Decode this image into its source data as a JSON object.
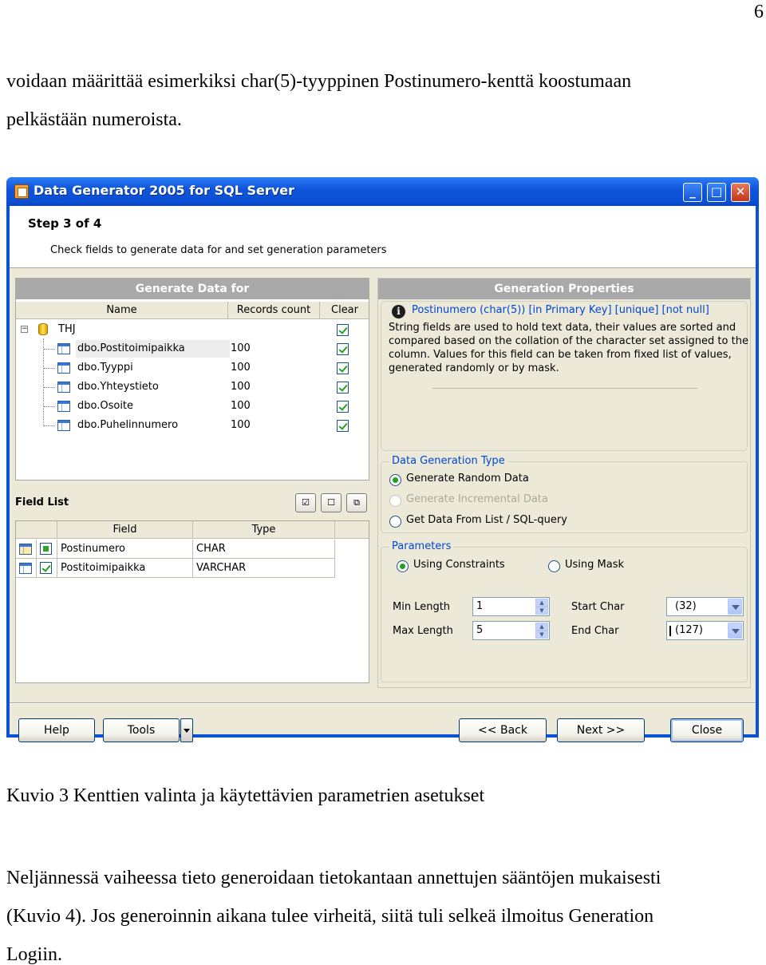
{
  "page": {
    "number": "6",
    "intro_line1": "voidaan määrittää esimerkiksi char(5)-tyyppinen Postinumero-kenttä koostumaan",
    "intro_line2": "pelkästään numeroista.",
    "caption": "Kuvio 3 Kenttien valinta ja käytettävien parametrien asetukset",
    "outro_line1": "Neljännessä vaiheessa tieto generoidaan tietokantaan annettujen sääntöjen mukaisesti",
    "outro_line2": "(Kuvio 4). Jos generoinnin aikana tulee virheitä, siitä tuli selkeä ilmoitus Generation",
    "outro_line3": "Logiin."
  },
  "window": {
    "title": "Data Generator 2005 for SQL Server",
    "min_glyph": "_",
    "max_glyph": "□",
    "close_glyph": "✕",
    "step_title": "Step 3 of 4",
    "step_desc": "Check fields to generate data for and set generation parameters"
  },
  "generate_panel": {
    "title": "Generate Data for",
    "col_name": "Name",
    "col_records": "Records count",
    "col_clear": "Clear",
    "root": "THJ",
    "tables": [
      {
        "name": "dbo.Postitoimipaikka",
        "count": "100",
        "checked": true
      },
      {
        "name": "dbo.Tyyppi",
        "count": "100",
        "checked": true
      },
      {
        "name": "dbo.Yhteystieto",
        "count": "100",
        "checked": true
      },
      {
        "name": "dbo.Osoite",
        "count": "100",
        "checked": true
      },
      {
        "name": "dbo.Puhelinnumero",
        "count": "100",
        "checked": true
      }
    ]
  },
  "field_list": {
    "title": "Field List",
    "col_field": "Field",
    "col_type": "Type",
    "rows": [
      {
        "field": "Postinumero",
        "type": "CHAR",
        "checked": false
      },
      {
        "field": "Postitoimipaikka",
        "type": "VARCHAR",
        "checked": true
      }
    ],
    "tool_icons": [
      "check-all-icon",
      "uncheck-all-icon",
      "invert-selection-icon"
    ]
  },
  "properties": {
    "title": "Generation Properties",
    "field_heading": "Postinumero (char(5)) [in Primary Key] [unique] [not null]",
    "desc_line1": "String fields are used to hold text data, their values are sorted and",
    "desc_line2": "compared based on the collation of the character set assigned to the",
    "desc_line3": "column. Values for this field can be taken from fixed list of values,",
    "desc_line4": "generated randomly or by mask.",
    "gen_type_legend": "Data Generation Type",
    "opt_random": "Generate Random Data",
    "opt_incremental": "Generate Incremental Data",
    "opt_list": "Get Data From List / SQL-query",
    "selected_type": "random",
    "params_legend": "Parameters",
    "opt_constraints": "Using Constraints",
    "opt_mask": "Using Mask",
    "min_length_label": "Min Length",
    "min_length": "1",
    "max_length_label": "Max Length",
    "max_length": "5",
    "start_char_label": "Start Char",
    "start_char": "(32)",
    "end_char_label": "End Char",
    "end_char": "(127)"
  },
  "buttons": {
    "help": "Help",
    "tools": "Tools",
    "back": "<< Back",
    "next": "Next >>",
    "close": "Close"
  }
}
